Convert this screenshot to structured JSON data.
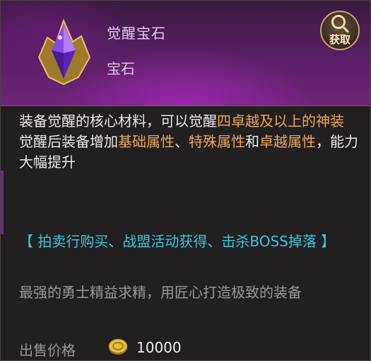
{
  "item": {
    "name": "觉醒宝石",
    "type": "宝石",
    "icon": "purple-gem-icon"
  },
  "acquire_button": {
    "label": "获取",
    "icon": "magnifier-icon"
  },
  "description": {
    "line1": [
      {
        "text": "装备觉醒的核心材料，可以觉醒",
        "style": "normal"
      },
      {
        "text": "四卓越及以上的神装",
        "style": "highlight"
      }
    ],
    "line2": [
      {
        "text": "觉醒后装备增加",
        "style": "normal"
      },
      {
        "text": "基础属性",
        "style": "highlight"
      },
      {
        "text": "、",
        "style": "normal"
      },
      {
        "text": "特殊属性",
        "style": "highlight"
      },
      {
        "text": "和",
        "style": "normal"
      },
      {
        "text": "卓越属性",
        "style": "highlight"
      },
      {
        "text": "，能力大幅提升",
        "style": "normal"
      }
    ]
  },
  "source_text": "【 拍卖行购买、战盟活动获得、击杀BOSS掉落 】",
  "flavor_text": "最强的勇士精益求精，用匠心打造极致的装备",
  "price": {
    "label": "出售价格",
    "value": "10000",
    "currency_icon": "gold-coin-icon"
  },
  "colors": {
    "highlight": "#e8a65c",
    "source": "#3fc4d6",
    "body": "#ece6e6",
    "muted": "#9a9596"
  }
}
